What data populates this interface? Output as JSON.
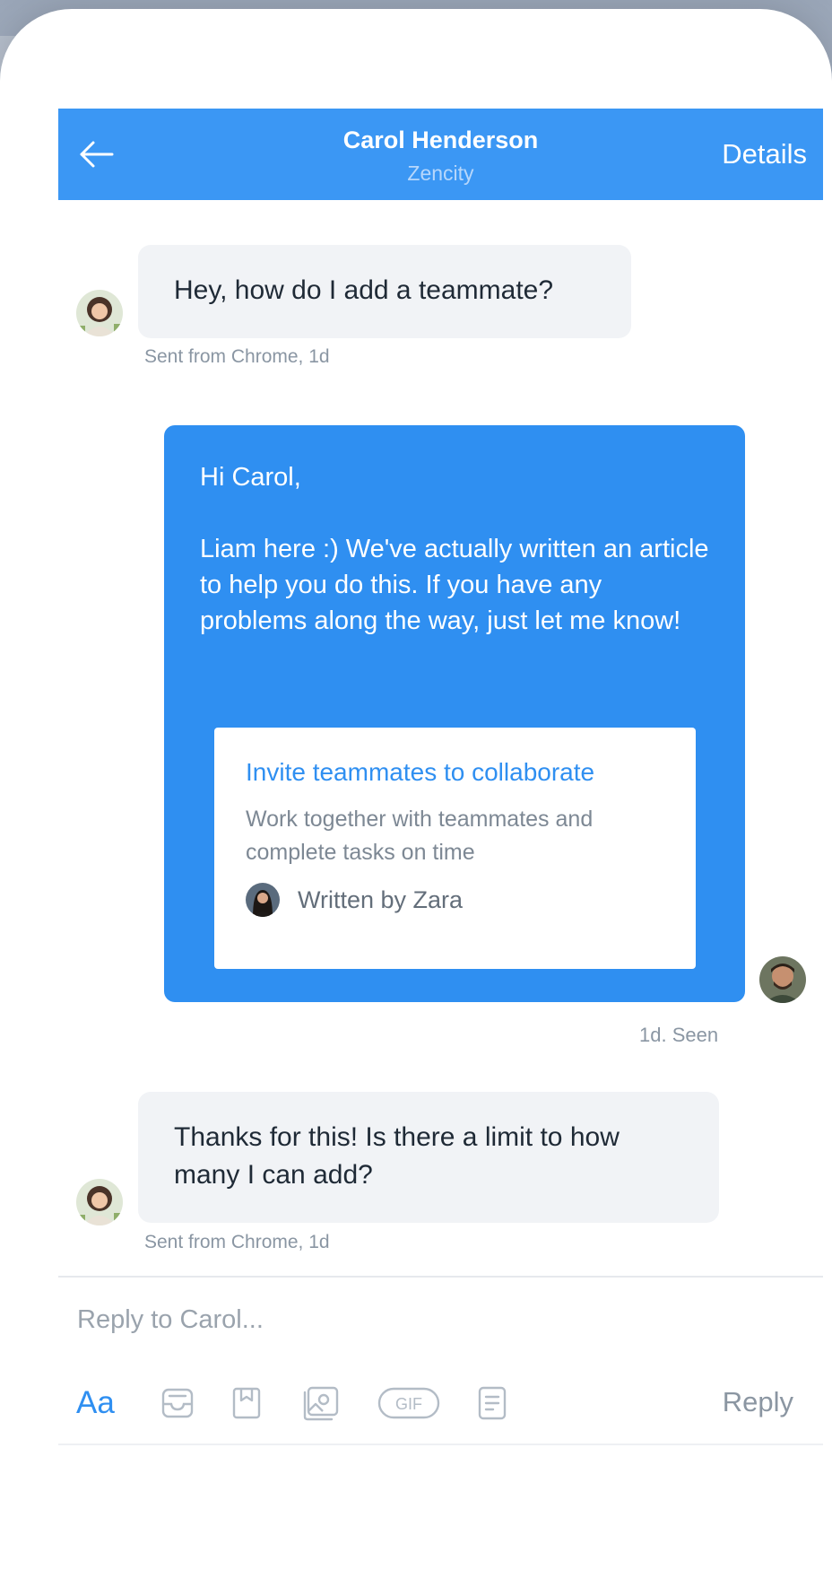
{
  "header": {
    "title": "Carol Henderson",
    "subtitle": "Zencity",
    "details_label": "Details",
    "back_icon": "arrow-left-icon",
    "background_color": "#3b97f4"
  },
  "messages": [
    {
      "from": "customer",
      "text": "Hey, how do I add a teammate?",
      "meta": "Sent from Chrome, 1d"
    },
    {
      "from": "agent",
      "greeting": "Hi Carol,",
      "body": "Liam here :) We've actually written an article to help you do this. If you have any problems along the way, just let me know!",
      "article": {
        "title": "Invite teammates to collaborate",
        "description": "Work together with teammates and complete tasks on time",
        "author": "Written by Zara"
      },
      "meta": "1d. Seen"
    },
    {
      "from": "customer",
      "text": "Thanks for this! Is there a limit to how many I can add?",
      "meta": "Sent from Chrome, 1d"
    }
  ],
  "composer": {
    "placeholder": "Reply to Carol...",
    "format_label": "Aa",
    "reply_label": "Reply",
    "tool_icons": [
      "inbox-icon",
      "bookmark-icon",
      "image-icon",
      "gif-icon",
      "note-icon"
    ],
    "gif_label": "GIF"
  },
  "colors": {
    "accent": "#2f8ff1",
    "incoming_bubble": "#f1f3f6",
    "meta_text": "#8a96a3"
  }
}
